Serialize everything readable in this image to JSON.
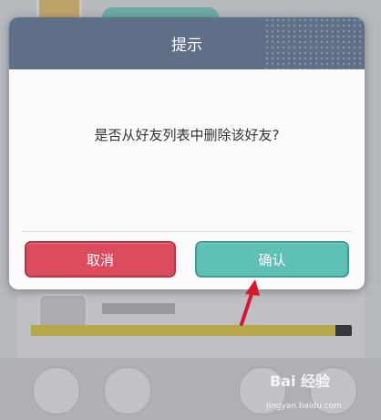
{
  "dialog": {
    "title": "提示",
    "message": "是否从好友列表中删除该好友?",
    "cancel_label": "取消",
    "confirm_label": "确认"
  },
  "background": {
    "progress_fraction": 0.95
  },
  "watermark": {
    "brand": "Bai 经验",
    "url": "jingyan.baidu.com"
  },
  "colors": {
    "header": "#5f6f87",
    "cancel": "#dc4c5f",
    "confirm": "#5cc0b4",
    "arrow": "#d8182c"
  },
  "icons": {
    "annotation": "red-arrow-icon"
  }
}
